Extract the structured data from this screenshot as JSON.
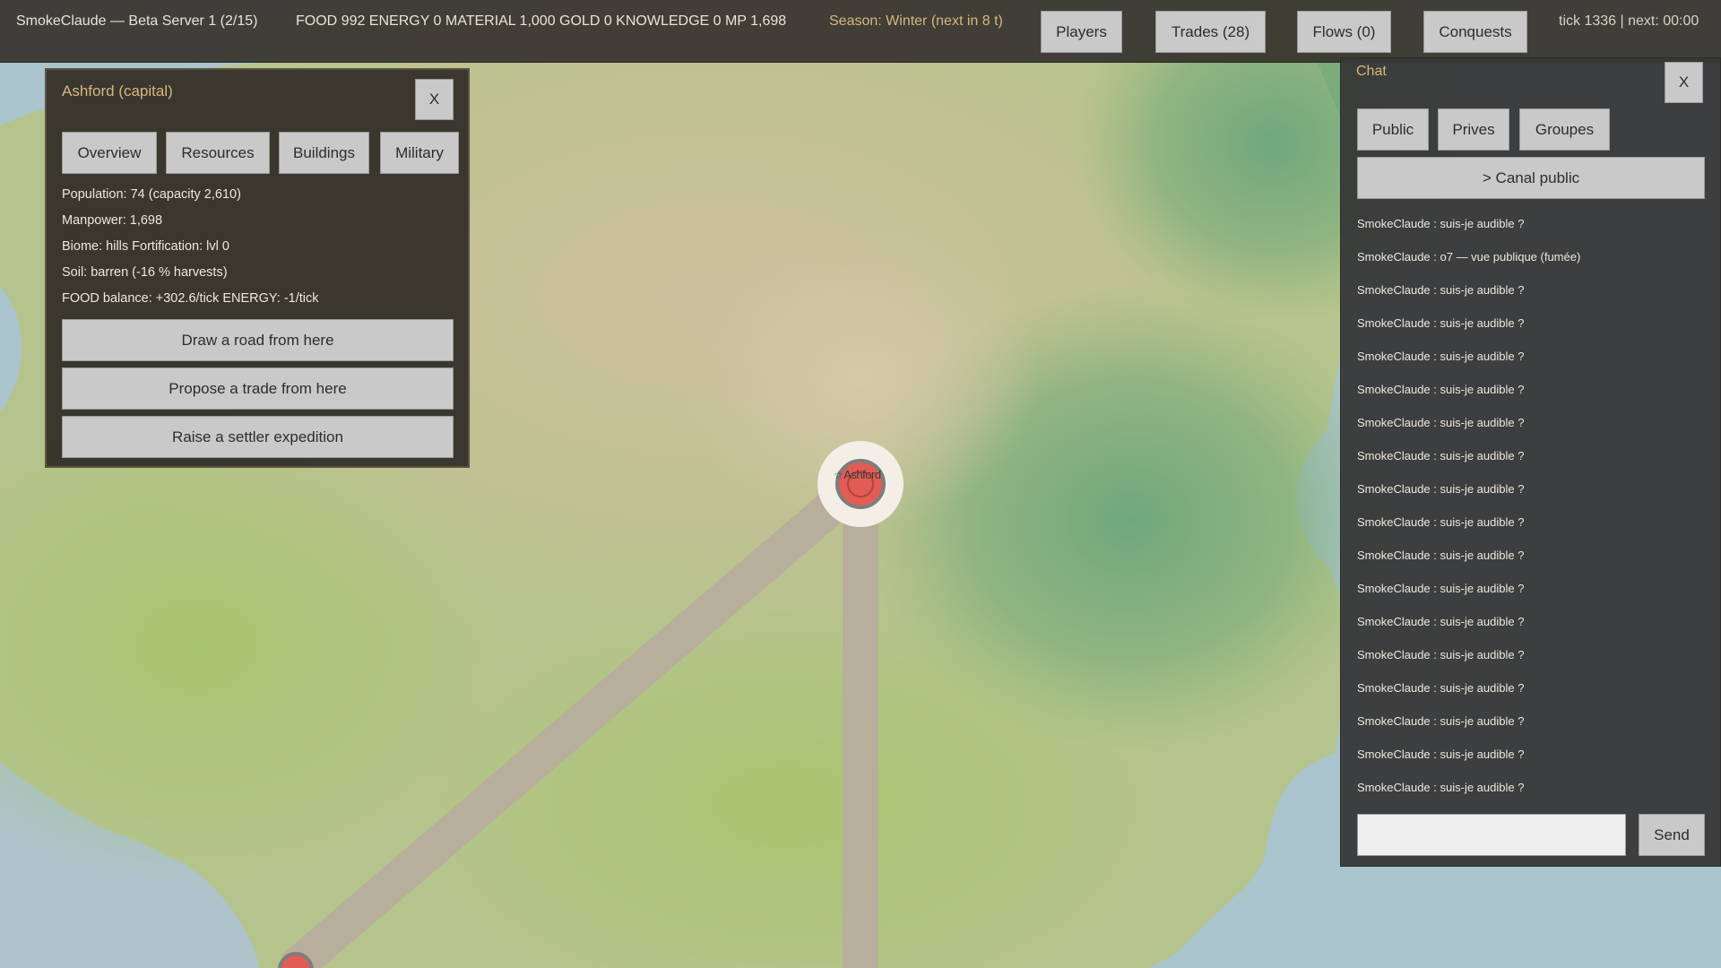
{
  "header": {
    "server_title": "SmokeClaude — Beta Server 1 (2/15)",
    "resources": "FOOD 992 ENERGY 0 MATERIAL 1,000 GOLD 0 KNOWLEDGE 0 MP 1,698",
    "season": "Season: Winter (next in 8 t)",
    "tick": "tick 1336 | next: 00:00",
    "buttons": {
      "players": "Players",
      "trades": "Trades (28)",
      "flows": "Flows (0)",
      "conquests": "Conquests"
    }
  },
  "city_panel": {
    "title": "Ashford (capital)",
    "close_label": "X",
    "tabs": {
      "overview": "Overview",
      "resources": "Resources",
      "buildings": "Buildings",
      "military": "Military"
    },
    "info": {
      "population": "Population: 74 (capacity 2,610)",
      "manpower": "Manpower: 1,698",
      "biome": "Biome: hills Fortification: lvl 0",
      "soil": "Soil: barren (-16 % harvests)",
      "balance": "FOOD balance: +302.6/tick ENERGY: -1/tick"
    },
    "actions": {
      "road": "Draw a road from here",
      "trade": "Propose a trade from here",
      "settler": "Raise a settler expedition"
    }
  },
  "map": {
    "city_star": "☆",
    "city_name": "Ashford"
  },
  "chat": {
    "title": "Chat",
    "close_label": "X",
    "tabs": {
      "public": "Public",
      "prives": "Prives",
      "groupes": "Groupes"
    },
    "channel": "> Canal public",
    "messages": [
      "SmokeClaude : suis-je audible ?",
      "SmokeClaude : o7 — vue publique (fumée)",
      "SmokeClaude : suis-je audible ?",
      "SmokeClaude : suis-je audible ?",
      "SmokeClaude : suis-je audible ?",
      "SmokeClaude : suis-je audible ?",
      "SmokeClaude : suis-je audible ?",
      "SmokeClaude : suis-je audible ?",
      "SmokeClaude : suis-je audible ?",
      "SmokeClaude : suis-je audible ?",
      "SmokeClaude : suis-je audible ?",
      "SmokeClaude : suis-je audible ?",
      "SmokeClaude : suis-je audible ?",
      "SmokeClaude : suis-je audible ?",
      "SmokeClaude : suis-je audible ?",
      "SmokeClaude : suis-je audible ?",
      "SmokeClaude : suis-je audible ?",
      "SmokeClaude : suis-je audible ?"
    ],
    "input_value": "",
    "send_label": "Send"
  }
}
